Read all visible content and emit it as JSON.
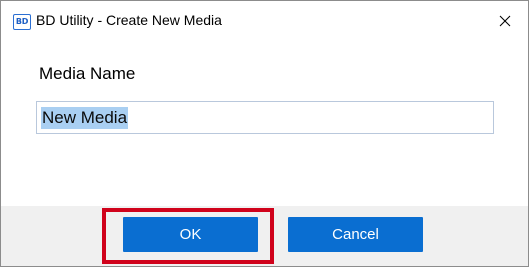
{
  "window": {
    "app_icon_text": "BD",
    "title": "BD Utility - Create New Media",
    "close_icon": "close-icon"
  },
  "form": {
    "media_name_label": "Media Name",
    "media_name_value": "New Media",
    "media_name_selected": true
  },
  "buttons": {
    "ok_label": "OK",
    "cancel_label": "Cancel"
  },
  "annotation": {
    "highlight_color": "#d0021b",
    "highlight_target": "ok-button"
  },
  "colors": {
    "button_bg": "#0a6ed1",
    "selection_bg": "#a9cff2",
    "footer_bg": "#f0f0f0"
  }
}
